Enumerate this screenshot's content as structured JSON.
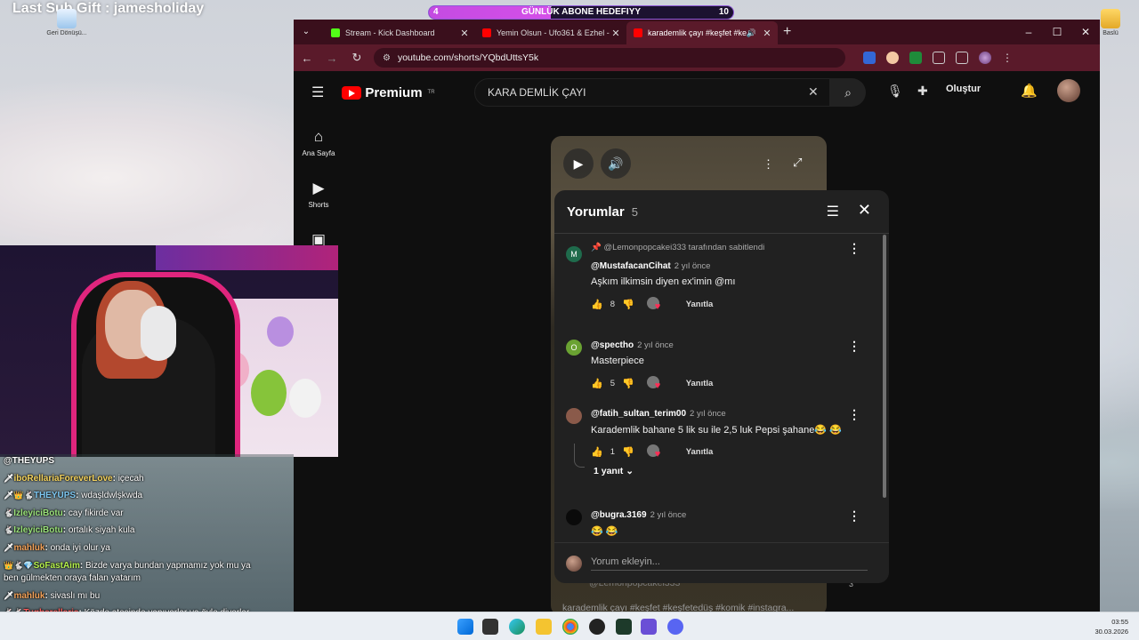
{
  "overlay": {
    "last_sub": "Last Sub Gift : jamesholiday",
    "goal": {
      "left_num": "4",
      "label": "GÜNLÜK ABONE HEDEFIYY",
      "right_num": "10",
      "progress": 0.4
    }
  },
  "desktop": {
    "icons": [
      {
        "label": "Geri Dönüşü..."
      },
      {
        "label": "Baslü"
      }
    ]
  },
  "browser": {
    "tabs": [
      {
        "label": "Stream - Kick Dashboard",
        "active": false,
        "color": "#53fc18"
      },
      {
        "label": "Yemin Olsun - Ufo361 & Ezhel - Yo",
        "active": false,
        "color": "#ff0000"
      },
      {
        "label": "karademlik çayı #keşfet #keşfe",
        "active": true,
        "color": "#ff0000"
      }
    ],
    "new_tab": "+",
    "window": {
      "minimize": "–",
      "maximize": "☐",
      "close": "✕"
    },
    "url": "youtube.com/shorts/YQbdUttsY5k"
  },
  "youtube": {
    "logo": "Premium",
    "logo_sup": "TR",
    "search_value": "KARA DEMLİK ÇAYI",
    "create_label": "Oluştur",
    "sidebar": [
      {
        "label": "Ana Sayfa",
        "icon": "home-icon"
      },
      {
        "label": "Shorts",
        "icon": "shorts-icon"
      }
    ],
    "caption": "karademlik çayı #keşfet #keşfetedüş #komik #instagra...",
    "caption_channel": "@Lemonpopcakei333",
    "side_count": "3"
  },
  "comments_panel": {
    "title": "Yorumlar",
    "count": "5",
    "add_placeholder": "Yorum ekleyin...",
    "reply_label": "Yanıtla",
    "comments": [
      {
        "pinned": "@Lemonpopcakei333 tarafından sabitlendi",
        "avatar_letter": "M",
        "avatar_color": "#1f6b4c",
        "author": "@MustafacanCihat",
        "time": "2 yıl önce",
        "text": "Aşkım ilkimsin diyen ex'imin @mı",
        "likes": "8"
      },
      {
        "avatar_letter": "O",
        "avatar_color": "#6aa232",
        "author": "@spectho",
        "time": "2 yıl önce",
        "text": "Masterpiece",
        "likes": "5"
      },
      {
        "avatar_letter": "",
        "avatar_color": "#8a5a4a",
        "author": "@fatih_sultan_terim00",
        "time": "2 yıl önce",
        "text": "Karademlik bahane 5 lik su ile 2,5 luk Pepsi şahane😂 😂",
        "likes": "1",
        "replies": "1 yanıt"
      },
      {
        "avatar_letter": "",
        "avatar_color": "#0a0a0a",
        "author": "@bugra.3169",
        "time": "2 yıl önce",
        "text": "😂 😂",
        "likes": ""
      }
    ]
  },
  "chat": {
    "header": "@THEYUPS",
    "lines": [
      {
        "badges": "🗡",
        "user": "iboRellariaForeverLove",
        "user_color": "#f4d35e",
        "msg": "içecah"
      },
      {
        "badges": "🗡👑🐇",
        "user": "THEYUPS",
        "user_color": "#7ec8f2",
        "msg": "wdaşldwlşkwda"
      },
      {
        "badges": "🐇",
        "user": "IzleyiciBotu",
        "user_color": "#9be37a",
        "msg": "cay fikirde var"
      },
      {
        "badges": "🐇",
        "user": "IzleyiciBotu",
        "user_color": "#9be37a",
        "msg": "ortalık siyah kula"
      },
      {
        "badges": "🗡",
        "user": "mahluk",
        "user_color": "#f4a259",
        "msg": "onda iyi olur ya"
      },
      {
        "badges": "👑🐇💎",
        "user": "SoFastAim",
        "user_color": "#b6f24c",
        "msg": "Bizde varya bundan yapmamız yok mu ya"
      },
      {
        "badges": "",
        "user": "",
        "user_color": "#ffffff",
        "msg": "ben gülmekten oraya falan yatarım"
      },
      {
        "badges": "🗡",
        "user": "mahluk",
        "user_color": "#f4a259",
        "msg": "sivaslı mı bu"
      },
      {
        "badges": "🐇🐇",
        "user": "Tugberellaria",
        "user_color": "#ff5a5a",
        "msg": "Közde ateşinde yapıyorlar ya öyle diyorlar"
      },
      {
        "badges": "🗡",
        "user": "iboRellariaForeverLove",
        "user_color": "#f4d35e",
        "msg": "normal demliğin karanıgı abla"
      }
    ]
  },
  "taskbar": {
    "time": "03:55",
    "date": "30.03.2026"
  },
  "colors": {
    "accent": "#ff0000",
    "browser_frame": "#5a1a2a",
    "panel": "#212121"
  }
}
